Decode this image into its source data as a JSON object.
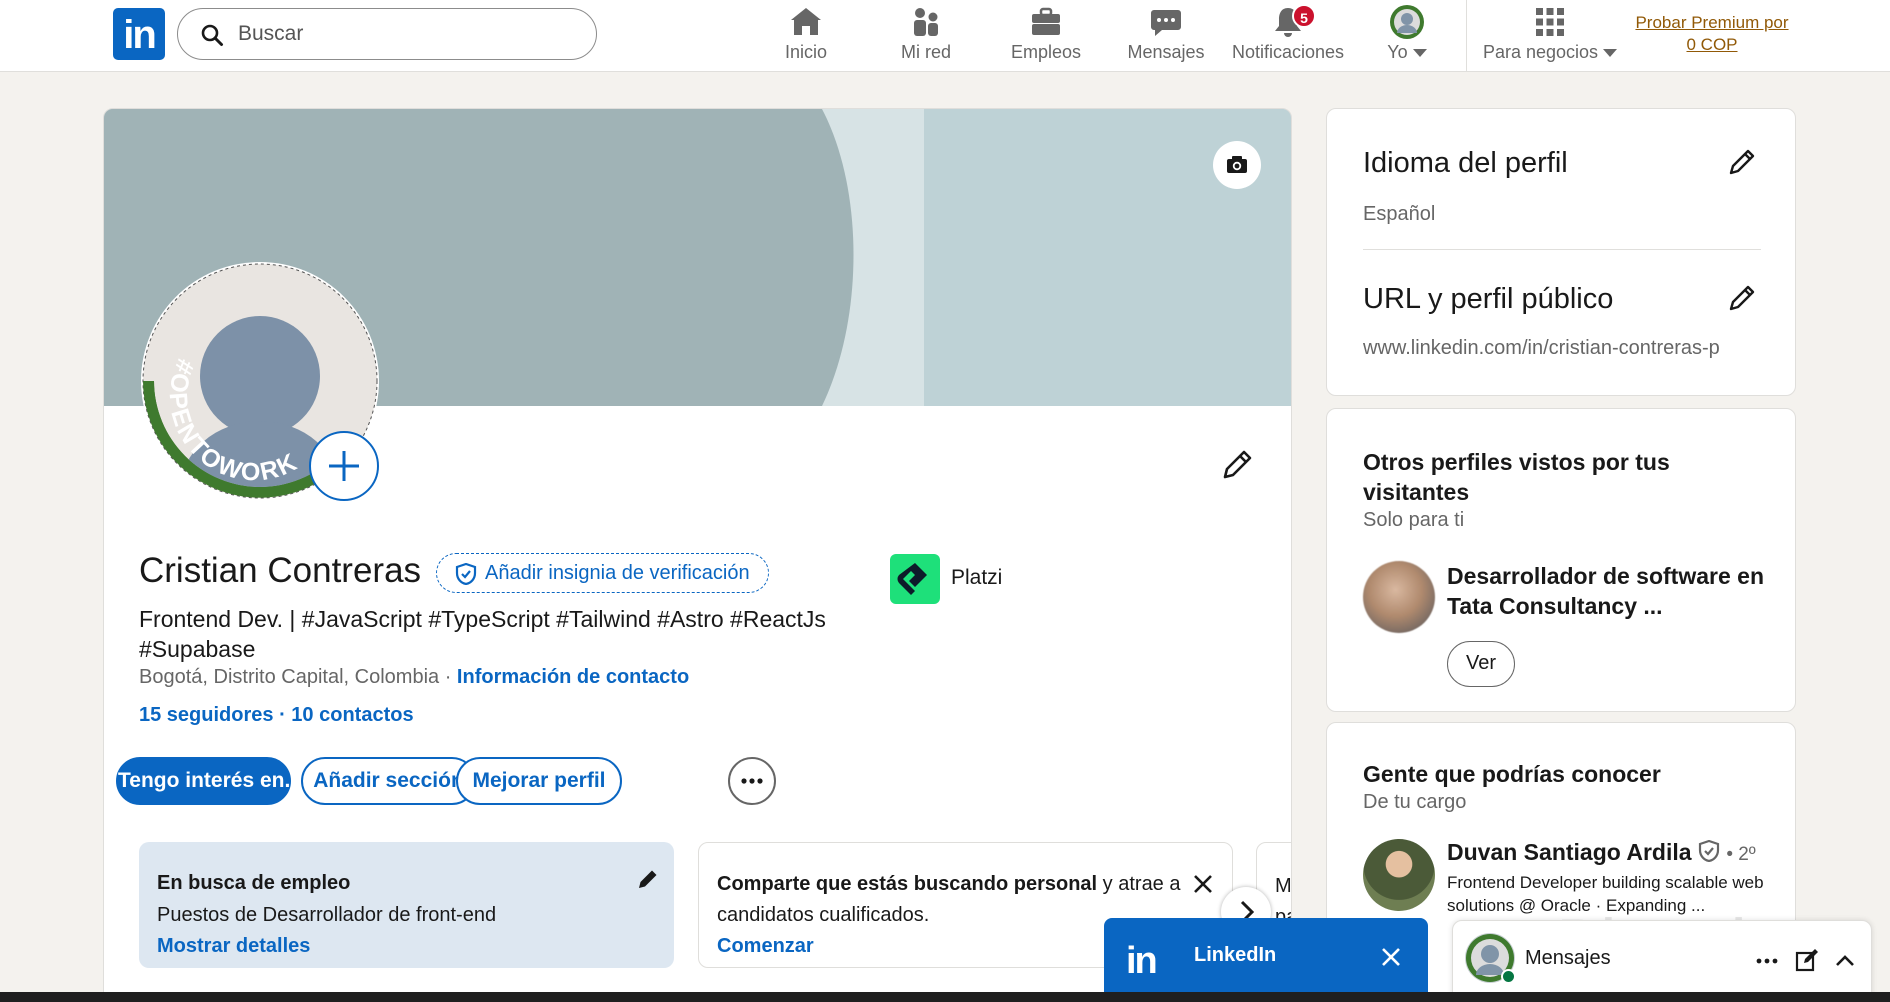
{
  "nav": {
    "logo_text": "in",
    "search_placeholder": "Buscar",
    "items": [
      {
        "label": "Inicio",
        "icon": "home-icon"
      },
      {
        "label": "Mi red",
        "icon": "network-icon"
      },
      {
        "label": "Empleos",
        "icon": "briefcase-icon"
      },
      {
        "label": "Mensajes",
        "icon": "message-icon"
      },
      {
        "label": "Notificaciones",
        "icon": "bell-icon",
        "badge": "5"
      },
      {
        "label": "Yo",
        "icon": "avatar-icon"
      },
      {
        "label": "Para negocios",
        "icon": "grid-icon"
      }
    ],
    "premium_line1": "Probar Premium por",
    "premium_line2": "0 COP"
  },
  "profile": {
    "name": "Cristian Contreras",
    "verify_label": "Añadir insignia de verificación",
    "headline": "Frontend Dev. | #JavaScript #TypeScript #Tailwind #Astro #ReactJs #Supabase",
    "location": "Bogotá, Distrito Capital, Colombia",
    "location_sep": " · ",
    "contact_info": "Información de contacto",
    "followers": "15 seguidores",
    "connections_sep": " · ",
    "connections": "10 contactos",
    "open_to_work_label": "#OPENTOWORK",
    "company_name": "Platzi",
    "buttons": {
      "interest": "Tengo interés en...",
      "add_section": "Añadir sección",
      "improve": "Mejorar perfil"
    },
    "job_box": {
      "title": "En busca de empleo",
      "role": "Puestos de Desarrollador de front-end",
      "link": "Mostrar detalles"
    },
    "share_box": {
      "bold": "Comparte que estás buscando personal",
      "rest": " y atrae a candidatos cualificados.",
      "link": "Comenzar"
    },
    "third_box": {
      "line1": "M",
      "line2": "pa"
    }
  },
  "sidebar": {
    "language_title": "Idioma del perfil",
    "language_value": "Español",
    "url_title": "URL y perfil público",
    "url_value": "www.linkedin.com/in/cristian-contreras-p",
    "others_title": "Otros perfiles vistos por tus visitantes",
    "others_sub": "Solo para ti",
    "visitor_text": "Desarrollador de software en Tata Consultancy ...",
    "view_button": "Ver",
    "pymk_title": "Gente que podrías conocer",
    "pymk_sub": "De tu cargo",
    "pymk_name": "Duvan Santiago Ardila",
    "pymk_degree": " • 2º",
    "pymk_desc": "Frontend Developer building scalable web solutions @ Oracle · Expanding ..."
  },
  "messaging": {
    "popup_logo": "in",
    "popup_title": "LinkedIn",
    "bar_title": "Mensajes"
  },
  "watermark": "Platzi",
  "colors": {
    "brand_blue": "#0a66c2",
    "open_to_work_green": "#3f7a2e",
    "notification_red": "#cb112d",
    "premium_gold": "#915907"
  }
}
